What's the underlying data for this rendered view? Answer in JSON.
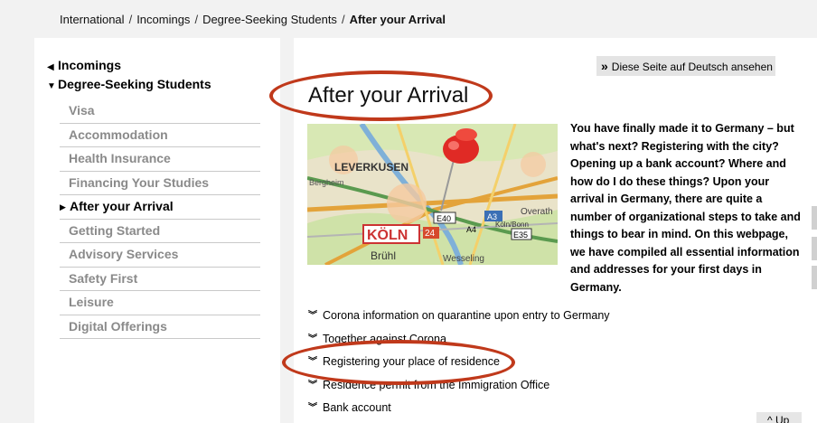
{
  "breadcrumb": {
    "items": [
      "International",
      "Incomings",
      "Degree-Seeking Students"
    ],
    "current": "After your Arrival"
  },
  "sidebar": {
    "back": "Incomings",
    "section": "Degree-Seeking Students",
    "items": [
      {
        "label": "Visa"
      },
      {
        "label": "Accommodation"
      },
      {
        "label": "Health Insurance"
      },
      {
        "label": "Financing Your Studies"
      },
      {
        "label": "After your Arrival"
      },
      {
        "label": "Getting Started"
      },
      {
        "label": "Advisory Services"
      },
      {
        "label": "Safety First"
      },
      {
        "label": "Leisure"
      },
      {
        "label": "Digital Offerings"
      }
    ]
  },
  "content": {
    "lang_button": "Diese Seite auf Deutsch ansehen",
    "title": "After your Arrival",
    "intro": "You have finally made it to Germany – but what's next? Registering with the city? Opening up a bank account? Where and how do I do these things? Upon your arrival in Germany, there are quite a number of organizational steps to take and things to bear in mind. On this webpage, we have compiled all essential information and addresses for your first days in Germany.",
    "map": {
      "city": "KÖLN",
      "labels": [
        "LEVERKUSEN",
        "Bergheim",
        "Brühl",
        "Wesseling",
        "Overath",
        "Köln/Bonn",
        "E40",
        "A3",
        "E35",
        "A4",
        "24"
      ]
    },
    "links": [
      "Corona information on quarantine upon entry to Germany",
      "Together against Corona",
      "Registering your place of residence",
      "Residence permit from the Immigration Office",
      "Bank account"
    ]
  },
  "footer": {
    "up": "Up"
  },
  "colors": {
    "annotation": "#c0391b",
    "inactive_nav": "#8a8a8a",
    "lang_bg": "#e4e4e4"
  }
}
